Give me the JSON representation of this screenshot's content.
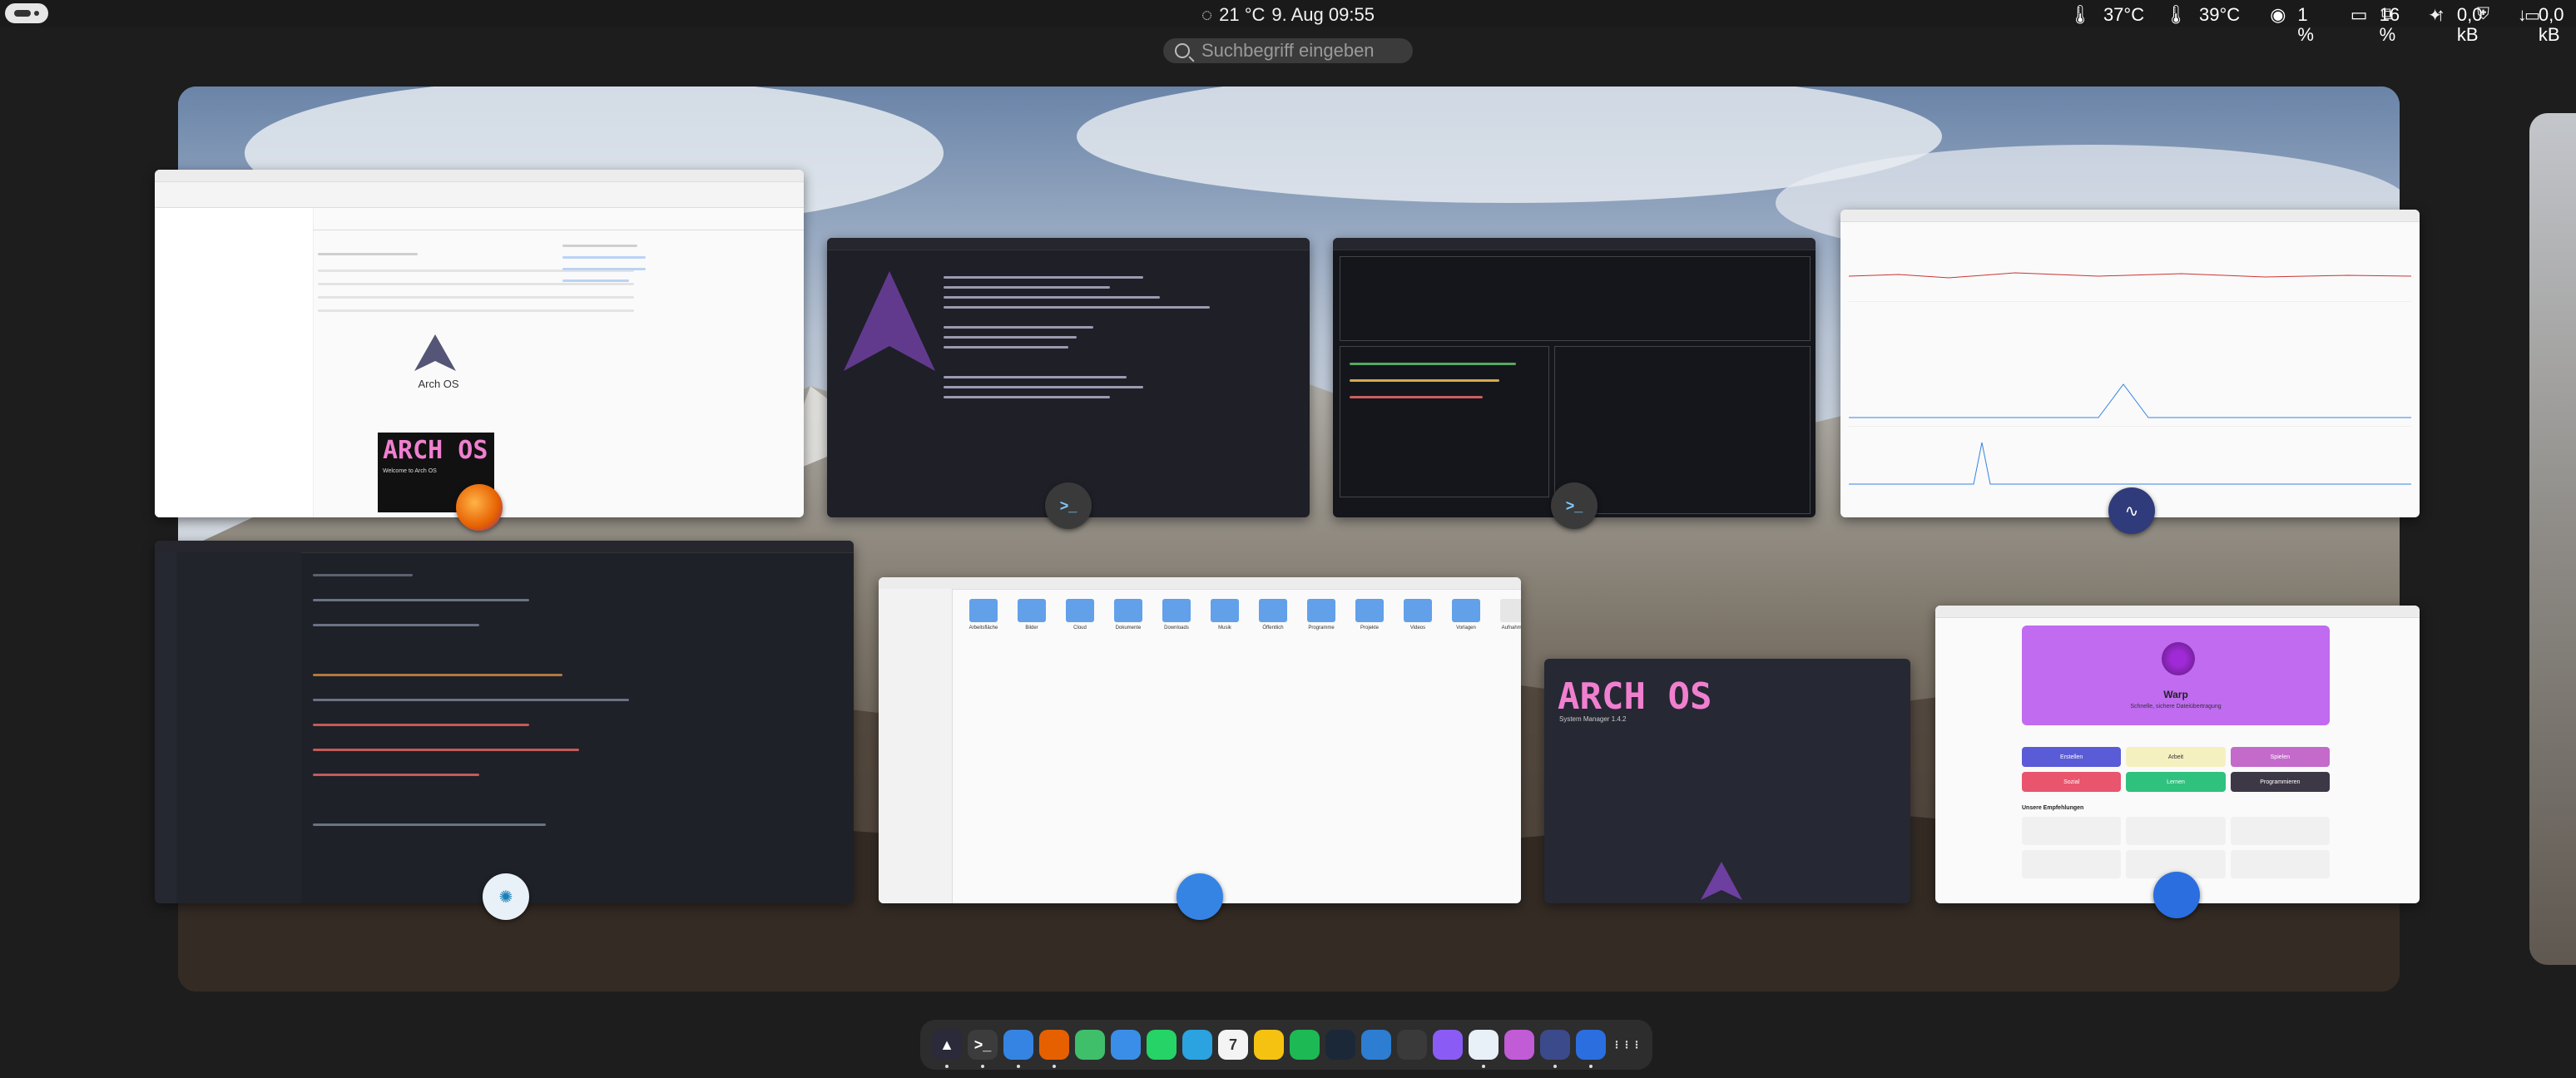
{
  "topbar": {
    "weather": "21 °C",
    "datetime": "9. Aug  09:55",
    "cpu_temp": "37°C",
    "gpu_temp": "39°C",
    "cpu_load": "1 %",
    "memory": "16 %",
    "net_up": "0,0 kB",
    "net_down": "0,0 kB"
  },
  "search": {
    "placeholder": "Suchbegriff eingeben"
  },
  "windows": {
    "browser": {
      "app": "firefox",
      "logo_text": "Arch OS",
      "banner_text": "ARCH OS",
      "tagline": "Welcome to Arch OS"
    },
    "terminal_fetch": {
      "app": "terminal"
    },
    "terminal_btop": {
      "app": "terminal"
    },
    "monitor": {
      "app": "system-monitor"
    },
    "editor": {
      "app": "vscode"
    },
    "files": {
      "app": "files",
      "folders": [
        "Arbeitsfläche",
        "Bilder",
        "Cloud",
        "Dokumente",
        "Downloads",
        "Musik",
        "Öffentlich",
        "Programme",
        "Projekte",
        "Videos",
        "Vorlagen",
        "Aufnahmen"
      ]
    },
    "archos_splash": {
      "title": "ARCH OS",
      "subtitle": "System Manager 1.4.2"
    },
    "software": {
      "app": "software",
      "featured_name": "Warp",
      "featured_desc": "Schnelle, sichere Dateiübertragung",
      "categories": [
        "Erstellen",
        "Arbeit",
        "Spielen",
        "Sozial",
        "Lernen",
        "Programmieren"
      ],
      "section_title": "Unsere Empfehlungen"
    }
  },
  "dock": {
    "apps": [
      {
        "name": "arch-os",
        "color": "#2a2a3a",
        "glyph": "▲",
        "running": true
      },
      {
        "name": "console",
        "color": "#3c3c3c",
        "glyph": ">_",
        "running": true
      },
      {
        "name": "files",
        "color": "#3584e4",
        "glyph": "",
        "running": true
      },
      {
        "name": "firefox",
        "color": "#e66000",
        "glyph": "",
        "running": true
      },
      {
        "name": "maps",
        "color": "#3fbf6a",
        "glyph": "",
        "running": false
      },
      {
        "name": "browser-alt",
        "color": "#3b8ee8",
        "glyph": "",
        "running": false
      },
      {
        "name": "whatsapp",
        "color": "#25d366",
        "glyph": "",
        "running": false
      },
      {
        "name": "telegram",
        "color": "#2aa3e0",
        "glyph": "",
        "running": false
      },
      {
        "name": "calendar",
        "color": "#f4f4f4",
        "glyph": "7",
        "running": false
      },
      {
        "name": "notes",
        "color": "#f5c211",
        "glyph": "",
        "running": false
      },
      {
        "name": "spotify",
        "color": "#1db954",
        "glyph": "",
        "running": false
      },
      {
        "name": "steam",
        "color": "#1b2838",
        "glyph": "",
        "running": false
      },
      {
        "name": "vscode",
        "color": "#2d7dd2",
        "glyph": "",
        "running": false
      },
      {
        "name": "extensions",
        "color": "#3a3a3a",
        "glyph": "",
        "running": false
      },
      {
        "name": "twitch",
        "color": "#8a5cf5",
        "glyph": "",
        "running": false
      },
      {
        "name": "gitkraken",
        "color": "#e8f0f8",
        "glyph": "",
        "running": true
      },
      {
        "name": "app-purple",
        "color": "#c15bd6",
        "glyph": "",
        "running": false
      },
      {
        "name": "system-monitor",
        "color": "#3b4a8a",
        "glyph": "",
        "running": true
      },
      {
        "name": "software",
        "color": "#2a6ee0",
        "glyph": "",
        "running": true
      },
      {
        "name": "show-apps",
        "color": "transparent",
        "glyph": "⋮⋮⋮",
        "running": false
      }
    ]
  }
}
